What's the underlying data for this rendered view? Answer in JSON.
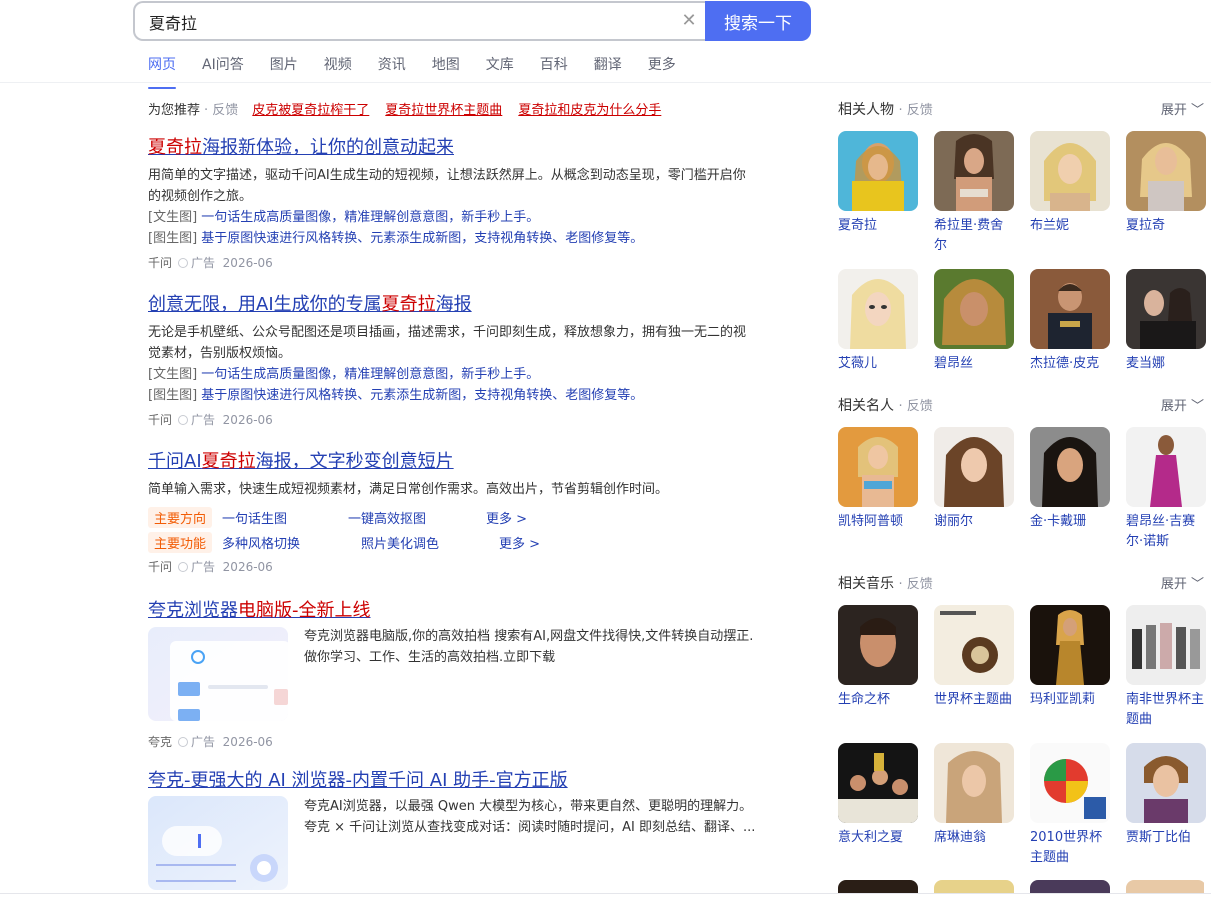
{
  "search": {
    "query": "夏奇拉",
    "button_label": "搜索一下"
  },
  "tabs": [
    "网页",
    "AI问答",
    "图片",
    "视频",
    "资讯",
    "地图",
    "文库",
    "百科",
    "翻译",
    "更多"
  ],
  "recommend": {
    "label": "为您推荐",
    "feedback": "· 反馈",
    "links": [
      "皮克被夏奇拉榨干了",
      "夏奇拉世界杯主题曲",
      "夏奇拉和皮克为什么分手"
    ]
  },
  "results": [
    {
      "title_hl": "夏奇拉",
      "title_rest": "海报新体验，让你的创意动起来",
      "desc": "用简单的文字描述，驱动千问AI生成生动的短视频，让想法跃然屏上。从概念到动态呈现，零门槛开启你的视频创作之旅。",
      "line1_tag": "[文生图]",
      "line1_link": "一句话生成高质量图像，精准理解创意意图，新手秒上手。",
      "line2_tag": "[图生图]",
      "line2_link": "基于原图快速进行风格转换、元素添生成新图，支持视角转换、老图修复等。",
      "source": "千问",
      "ad": "广告",
      "date": "2026-06"
    },
    {
      "title_pre": "创意无限，用AI生成你的专属",
      "title_hl": "夏奇拉",
      "title_post": "海报",
      "desc": "无论是手机壁纸、公众号配图还是项目插画，描述需求，千问即刻生成，释放想象力，拥有独一无二的视觉素材，告别版权烦恼。",
      "line1_tag": "[文生图]",
      "line1_link": "一句话生成高质量图像，精准理解创意意图，新手秒上手。",
      "line2_tag": "[图生图]",
      "line2_link": "基于原图快速进行风格转换、元素添生成新图，支持视角转换、老图修复等。",
      "source": "千问",
      "ad": "广告",
      "date": "2026-06"
    },
    {
      "title_pre": "千问AI",
      "title_hl": "夏奇拉",
      "title_post": "海报，文字秒变创意短片",
      "desc": "简单输入需求，快速生成短视频素材，满足日常创作需求。高效出片，节省剪辑创作时间。",
      "chip1": "主要方向",
      "chip1_links": [
        "一句话生图",
        "一键高效抠图"
      ],
      "chip1_more": "更多 >",
      "chip2": "主要功能",
      "chip2_links": [
        "多种风格切换",
        "照片美化调色"
      ],
      "chip2_more": "更多 >",
      "source": "千问",
      "ad": "广告",
      "date": "2026-06"
    },
    {
      "title_pre": "夸克浏览器",
      "title_hl": "电脑版-全新上线",
      "desc": "夸克浏览器电脑版,你的高效拍档 搜索有AI,网盘文件找得快,文件转换自动摆正.做你学习、工作、生活的高效拍档.立即下载",
      "source": "夸克",
      "ad": "广告",
      "date": "2026-06"
    },
    {
      "title": "夸克-更强大的 AI 浏览器-内置千问 AI 助手-官方正版",
      "desc1": "夸克AI浏览器，以最强 Qwen 大模型为核心，带来更自然、更聪明的理解力。",
      "desc2": "夸克 × 千问让浏览从查找变成对话：阅读时随时提问，AI 即刻总结、翻译、..."
    }
  ],
  "right": {
    "feedback": "· 反馈",
    "expand": "展开",
    "sections": [
      {
        "title": "相关人物",
        "items": [
          "夏奇拉",
          "希拉里·费舍尔",
          "布兰妮",
          "夏拉奇",
          "艾薇儿",
          "碧昂丝",
          "杰拉德·皮克",
          "麦当娜"
        ]
      },
      {
        "title": "相关名人",
        "items": [
          "凯特阿普顿",
          "谢丽尔",
          "金·卡戴珊",
          "碧昂丝·吉赛尔·诺斯"
        ]
      },
      {
        "title": "相关音乐",
        "items": [
          "生命之杯",
          "世界杯主题曲",
          "玛利亚凯莉",
          "南非世界杯主题曲",
          "意大利之夏",
          "席琳迪翁",
          "2010世界杯主题曲",
          "贾斯丁比伯"
        ]
      }
    ]
  },
  "colors": {
    "accent": "#4e6ef2",
    "link": "#2440b3",
    "highlight": "#cc0000"
  }
}
